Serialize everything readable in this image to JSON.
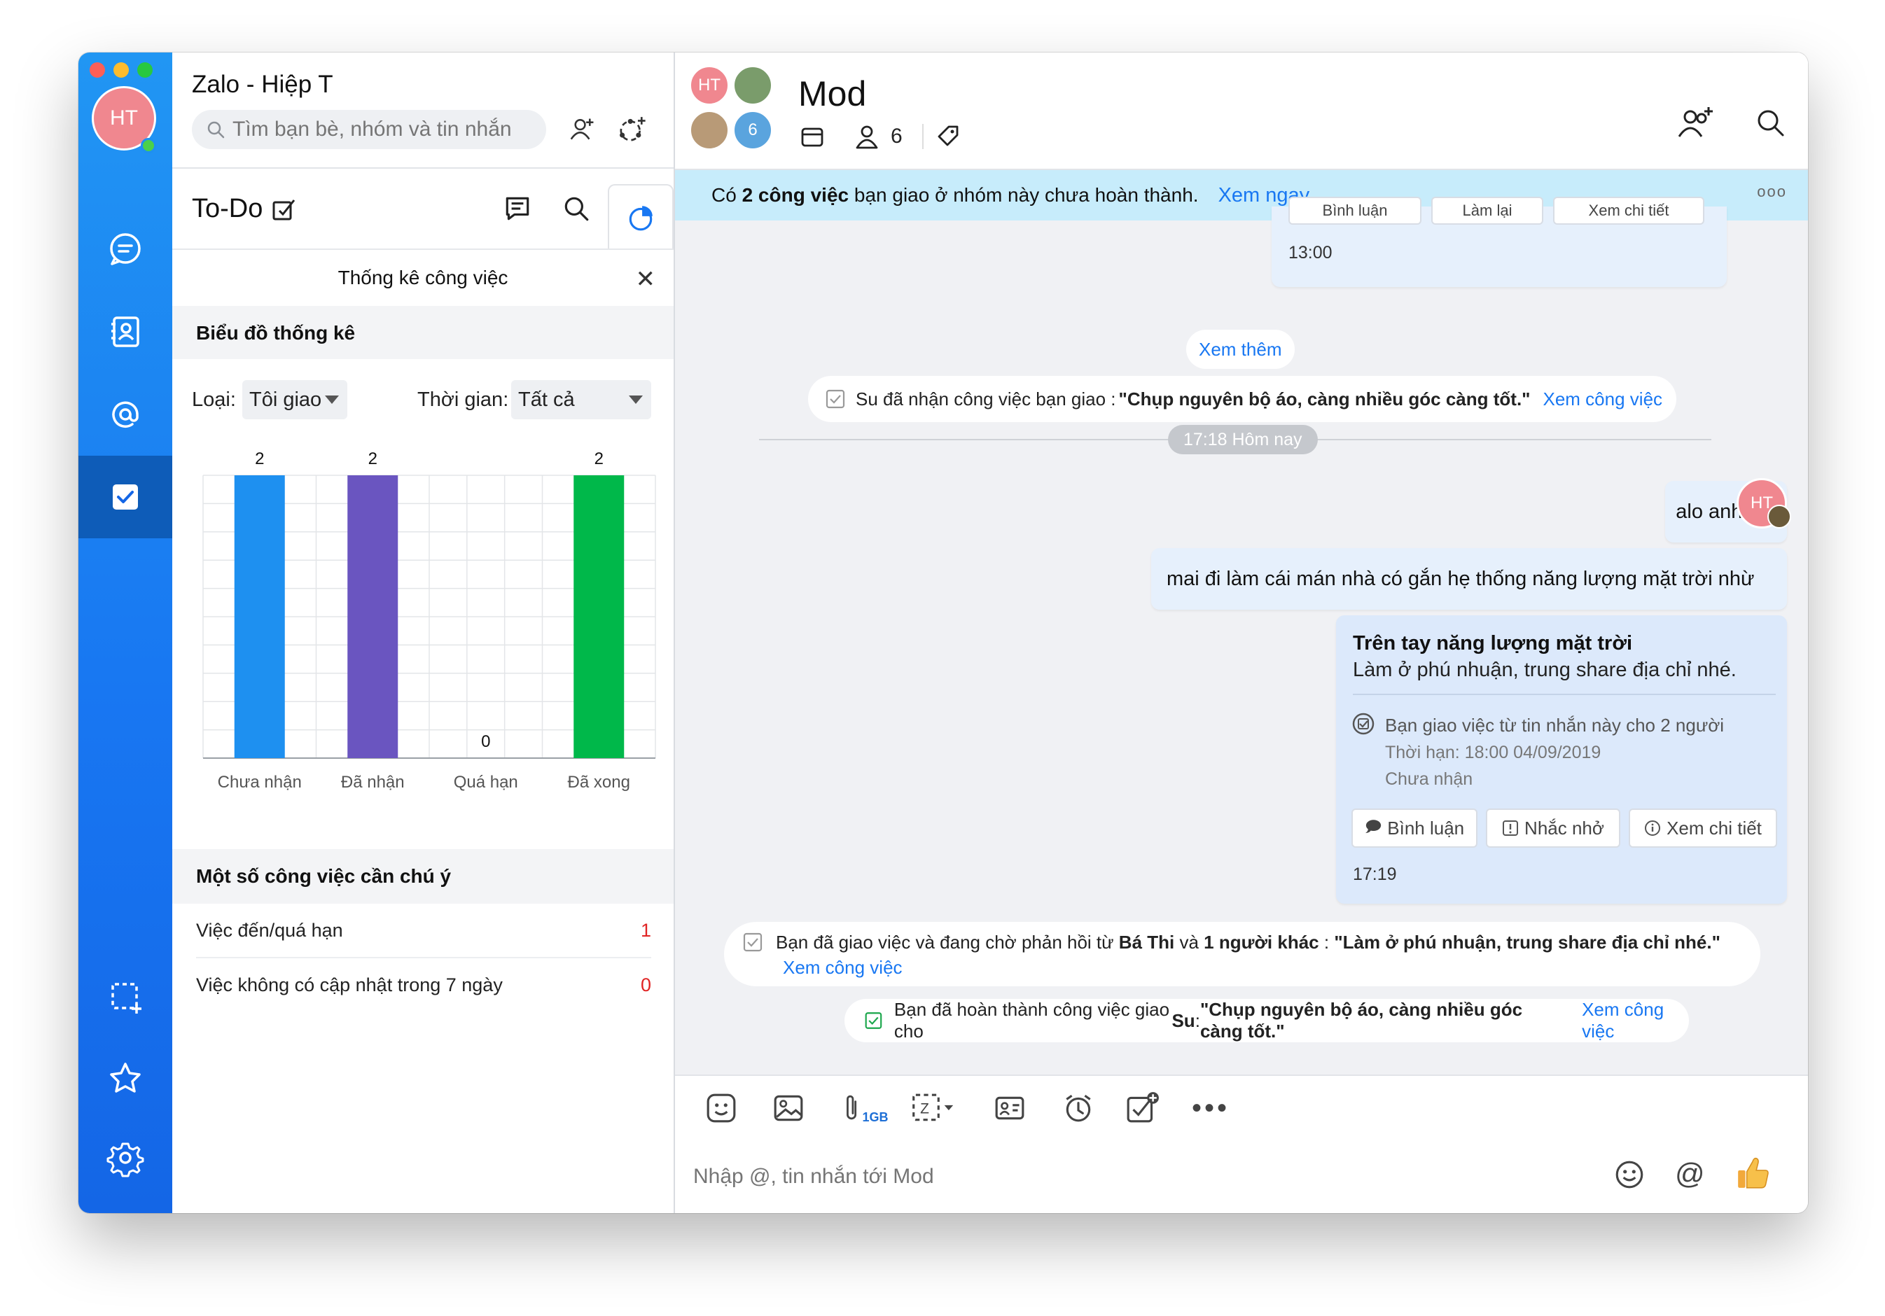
{
  "window": {
    "app_title": "Zalo - Hiệp T",
    "user_initials": "HT"
  },
  "search": {
    "placeholder": "Tìm bạn bè, nhóm và tin nhắn"
  },
  "todo": {
    "title": "To-Do",
    "stats_title": "Thống kê công việc",
    "chart_section": "Biểu đồ thống kê",
    "filter_type_label": "Loại:",
    "filter_type_value": "Tôi giao",
    "filter_time_label": "Thời gian:",
    "filter_time_value": "Tất cả",
    "attention_section": "Một số công việc cần chú ý",
    "attention_items": [
      {
        "label": "Việc đến/quá hạn",
        "count": "1"
      },
      {
        "label": "Việc không có cập nhật trong 7 ngày",
        "count": "0"
      }
    ]
  },
  "chart_data": {
    "type": "bar",
    "categories": [
      "Chưa nhận",
      "Đã nhận",
      "Quá hạn",
      "Đã xong"
    ],
    "values": [
      2,
      2,
      0,
      2
    ],
    "value_labels": [
      "2",
      "2",
      "0",
      "2"
    ],
    "colors": [
      "#1e90f0",
      "#6a55c0",
      "#ffffff",
      "#00b84a"
    ],
    "ylim": [
      0,
      2
    ],
    "grid": true
  },
  "chat": {
    "name": "Mod",
    "member_count": "6",
    "avatar_badge": "6",
    "avatar_initials": "HT",
    "banner_pre": "Có ",
    "banner_bold": "2 công việc",
    "banner_post": " bạn giao ở nhóm này chưa hoàn thành.",
    "banner_link": "Xem ngay",
    "banner_dots": "ooo",
    "top_partial_buttons": [
      "Bình luận",
      "Làm lại",
      "Xem chi tiết"
    ],
    "top_time": "13:00",
    "see_more": "Xem thêm",
    "sys1_pre": "Su đã nhận công việc bạn giao : ",
    "sys1_bold": "\"Chụp nguyên bộ áo, càng nhiều góc càng tốt.\"",
    "sys1_link": "Xem công việc",
    "divider_time": "17:18 Hôm nay",
    "msg1": "alo anh em",
    "msg2": "mai đi làm cái mán nhà có gắn hẹ thống năng lượng mặt trời nhừ",
    "task_title": "Trên tay năng lượng mặt trời",
    "task_desc": "Làm ở phú nhuận, trung share địa chỉ nhé.",
    "task_assign": "Bạn giao việc từ tin nhắn này cho 2 người",
    "task_deadline": "Thời hạn: 18:00 04/09/2019",
    "task_status": "Chưa nhận",
    "task_btn_comment": "Bình luận",
    "task_btn_remind": "Nhắc nhở",
    "task_btn_detail": "Xem chi tiết",
    "task_time": "17:19",
    "sys2_pre": "Bạn đã giao việc và đang chờ phản hồi từ ",
    "sys2_bold1": "Bá Thi",
    "sys2_mid": " và ",
    "sys2_bold2": "1 người khác",
    "sys2_mid2": " : ",
    "sys2_bold3": "\"Làm ở phú nhuận, trung share địa chỉ nhé.\"",
    "sys2_link": "Xem công việc",
    "sys3_pre": "Bạn đã hoàn thành công việc giao cho ",
    "sys3_bold1": "Su",
    "sys3_mid": " : ",
    "sys3_bold2": "\"Chụp nguyên bộ áo, càng nhiều góc càng tốt.\"",
    "sys3_link": "Xem công việc",
    "attach_size": "1GB",
    "input_placeholder": "Nhập @, tin nhắn tới Mod"
  },
  "colors": {
    "accent": "#1877f2",
    "sidebar": "#1e88f0",
    "badge_red": "#e02424",
    "banner": "#c7ecfb"
  }
}
